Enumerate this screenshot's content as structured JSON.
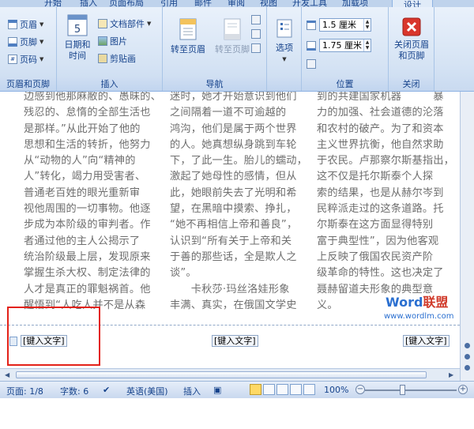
{
  "tabs": [
    {
      "label": "开始"
    },
    {
      "label": "插入"
    },
    {
      "label": "页面布局"
    },
    {
      "label": "引用"
    },
    {
      "label": "邮件"
    },
    {
      "label": "审阅"
    },
    {
      "label": "视图"
    },
    {
      "label": "开发工具"
    },
    {
      "label": "加载项"
    },
    {
      "label": "设计"
    }
  ],
  "ribbon": {
    "group_header_footer": {
      "title": "页眉和页脚",
      "items": [
        "页眉",
        "页脚",
        "页码"
      ]
    },
    "group_insert": {
      "title": "插入",
      "datetime": "日期和时间",
      "doc_parts": "文档部件",
      "picture": "图片",
      "clipart": "剪贴画"
    },
    "group_nav": {
      "title": "导航",
      "goto_header": "转至页眉",
      "goto_footer": "转至页脚"
    },
    "group_options": {
      "title": "",
      "options": "选项"
    },
    "group_position": {
      "title": "位置",
      "header_dist": "1.5 厘米",
      "footer_dist": "1.75 厘米"
    },
    "group_close": {
      "title": "关闭",
      "close_label": "关闭页眉和页脚"
    }
  },
  "document": {
    "col1": [
      "边感到他那麻敝的、愚昧的、",
      "残忍的、怠惰的全部生活也",
      "是那样。”从此开始了他的",
      "思想和生活的转折，他努力",
      "从“动物的人”向“精神的",
      "人”转化，竭力用受害者、",
      "普通老百姓的眼光重新审",
      "视他周围的一切事物。他逐",
      "步成为本阶级的审判者。作",
      "者通过他的主人公揭示了",
      "统治阶级最上层，发现原来",
      "掌握生杀大权、制定法律的",
      "人才是真正的罪魁祸首。他",
      "醒悟到“人吃人并不是从森"
    ],
    "col2": [
      "迷时，她才开始意识到他们",
      "之间隔着一道不可逾越的",
      "鸿沟，他们是属于两个世界",
      "的人。她真想纵身跳到车轮",
      "下，了此一生。胎儿的蠕动，",
      "激起了她母性的感情，但从",
      "此，她眼前失去了光明和希",
      "望，在黑暗中摸索、挣扎，",
      "“她不再相信上帝和善良”，",
      "认识到“所有关于上帝和关",
      "于善的那些话，全是欺人之",
      "谈”。",
      "　　卡秋莎·玛丝洛娃形象",
      "丰满、真实，在俄国文学史"
    ],
    "col3": [
      "到的共建国家机器　　　暴",
      "力的加强、社会道德的沦落",
      "和农村的破产。为了和资本",
      "主义世界抗衡，他自然求助",
      "于农民。卢那察尔斯基指出，",
      "这不仅是托尔斯泰个人探",
      "索的结果，也是从赫尔岑到",
      "民粹派走过的这条道路。托",
      "尔斯泰在这方面显得特别",
      "富于典型性”，因为他客观",
      "上反映了俄国农民资产阶",
      "级革命的特性。这也决定了",
      "聂赫留道夫形象的典型意",
      "义。"
    ],
    "footer_tags": [
      "[键入文字]",
      "[键入文字]",
      "[键入文字]"
    ]
  },
  "watermark": {
    "brand_a": "Word",
    "brand_b": "联盟",
    "url": "www.wordlm.com"
  },
  "status": {
    "page": "页面: 1/8",
    "words": "字数: 6",
    "lang": "英语(美国)",
    "mode": "插入",
    "zoom": "100%"
  },
  "colors": {
    "accent": "#15428b",
    "highlight_box": "#e32219"
  }
}
